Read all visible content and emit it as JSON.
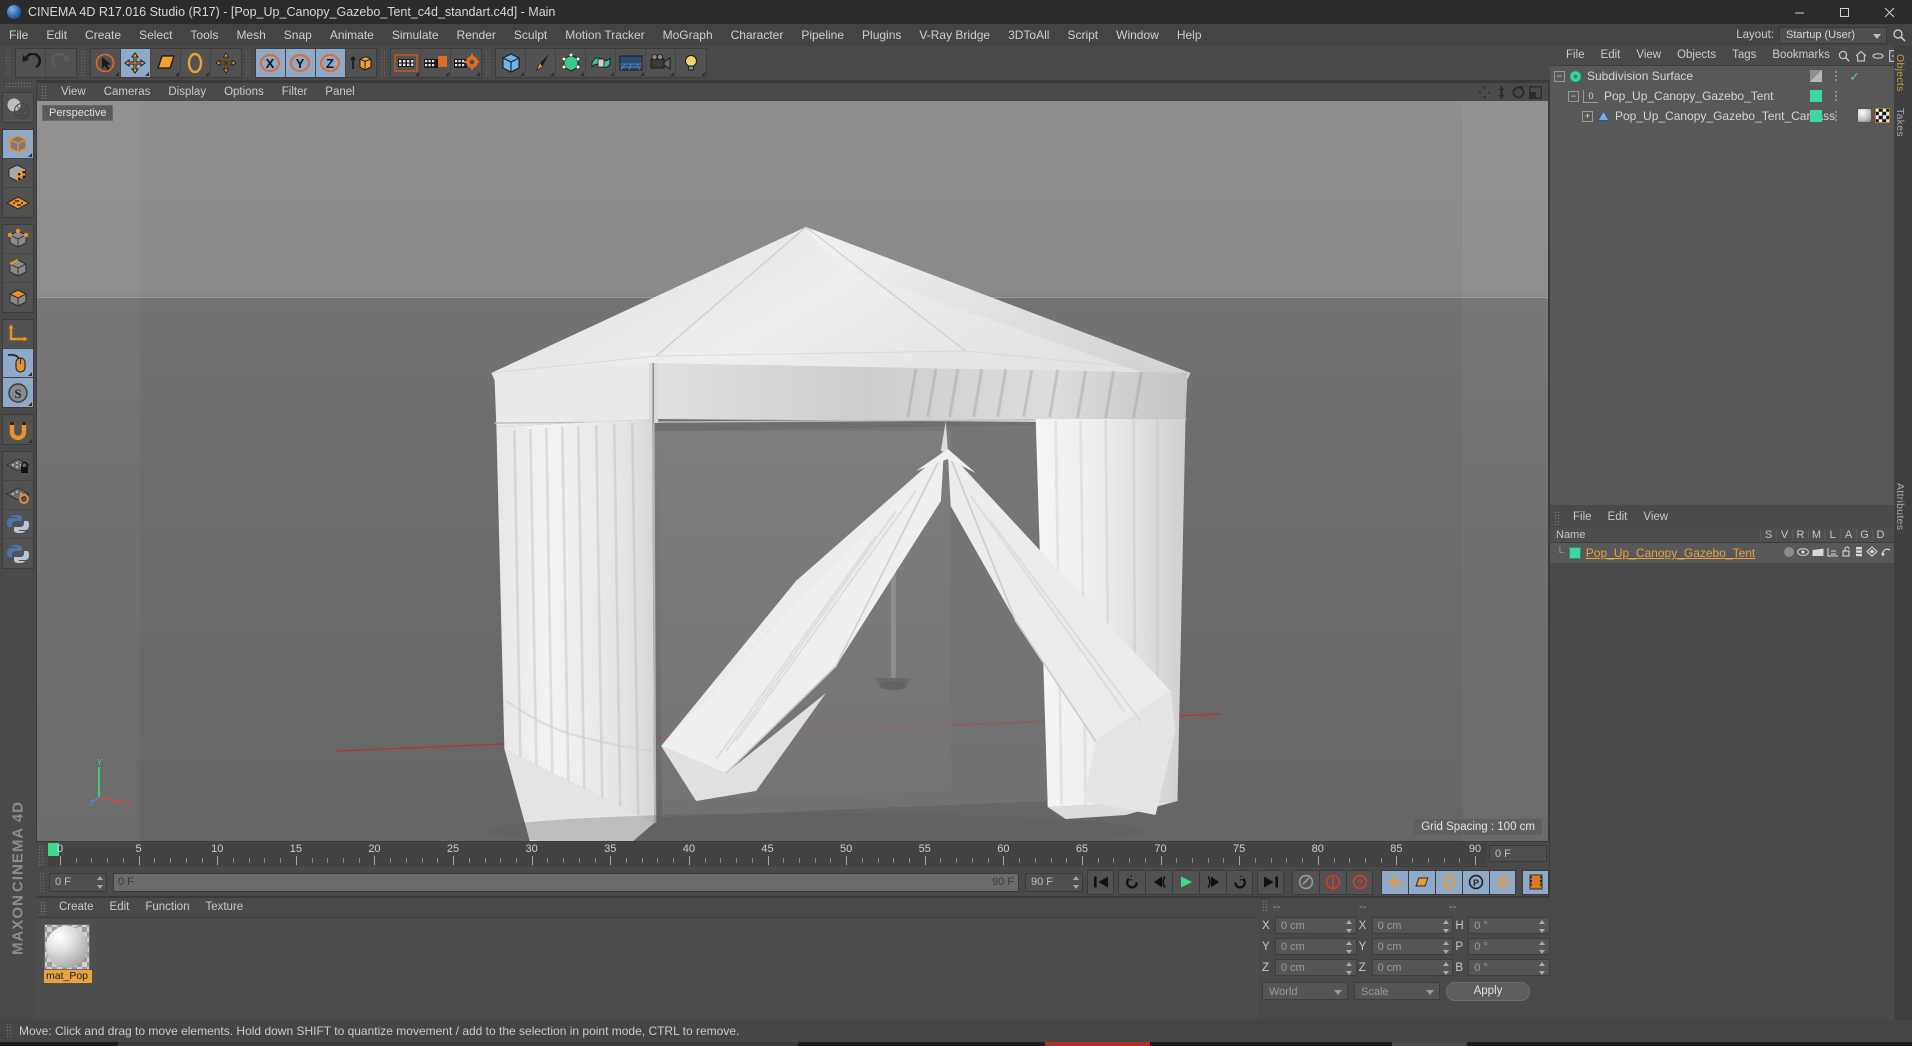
{
  "window": {
    "title": "CINEMA 4D R17.016 Studio (R17) - [Pop_Up_Canopy_Gazebo_Tent_c4d_standart.c4d] - Main",
    "app_icon": "cinema4d-logo-icon",
    "minimize": "minimize-icon",
    "maximize": "maximize-icon",
    "close": "close-icon"
  },
  "menubar": {
    "items": [
      "File",
      "Edit",
      "Create",
      "Select",
      "Tools",
      "Mesh",
      "Snap",
      "Animate",
      "Simulate",
      "Render",
      "Sculpt",
      "Motion Tracker",
      "MoGraph",
      "Character",
      "Pipeline",
      "Plugins",
      "V-Ray Bridge",
      "3DToAll",
      "Script",
      "Window",
      "Help"
    ],
    "layout_label": "Layout:",
    "layout_value": "Startup (User)"
  },
  "toolbar": {
    "groups": [
      {
        "name": "history",
        "buttons": [
          {
            "name": "undo-button",
            "icon": "undo-arrow-icon",
            "state": "normal"
          },
          {
            "name": "redo-button",
            "icon": "redo-arrow-icon",
            "state": "disabled"
          }
        ]
      },
      {
        "name": "transform-tools",
        "buttons": [
          {
            "name": "live-selection-tool",
            "icon": "cursor-select-icon",
            "state": "normal"
          },
          {
            "name": "move-tool",
            "icon": "move-arrows-icon",
            "state": "active"
          },
          {
            "name": "scale-tool",
            "icon": "scale-icon",
            "state": "normal"
          },
          {
            "name": "rotate-tool",
            "icon": "rotate-icon",
            "state": "normal"
          },
          {
            "name": "transform-tool",
            "icon": "transform-icon",
            "state": "normal"
          }
        ]
      },
      {
        "name": "axis-locks",
        "buttons": [
          {
            "name": "lock-x-axis",
            "icon": "x-axis-icon",
            "state": "active"
          },
          {
            "name": "lock-y-axis",
            "icon": "y-axis-icon",
            "state": "active"
          },
          {
            "name": "lock-z-axis",
            "icon": "z-axis-icon",
            "state": "active"
          },
          {
            "name": "world-object-coordinates",
            "icon": "world-axis-icon",
            "state": "normal"
          }
        ]
      },
      {
        "name": "render-tools",
        "buttons": [
          {
            "name": "render-view-button",
            "icon": "render-view-icon",
            "state": "normal"
          },
          {
            "name": "render-to-picture-viewer-button",
            "icon": "render-picture-icon",
            "state": "normal"
          },
          {
            "name": "edit-render-settings-button",
            "icon": "render-settings-icon",
            "state": "normal"
          }
        ]
      },
      {
        "name": "create-objects",
        "buttons": [
          {
            "name": "add-cube-button",
            "icon": "cube-icon",
            "state": "normal"
          },
          {
            "name": "add-spline-button",
            "icon": "pen-spline-icon",
            "state": "normal"
          },
          {
            "name": "add-generator-button",
            "icon": "generator-nurbs-icon",
            "state": "normal"
          },
          {
            "name": "add-deformer-button",
            "icon": "deformer-icon",
            "state": "normal"
          },
          {
            "name": "add-environment-button",
            "icon": "environment-floor-icon",
            "state": "normal"
          },
          {
            "name": "add-camera-button",
            "icon": "camera-icon",
            "state": "normal"
          },
          {
            "name": "add-light-button",
            "icon": "light-bulb-icon",
            "state": "normal"
          }
        ]
      }
    ]
  },
  "left_palette": {
    "groups": [
      {
        "buttons": [
          {
            "name": "make-editable-button",
            "icon": "make-editable-icon"
          }
        ]
      },
      {
        "buttons": [
          {
            "name": "model-mode-button",
            "icon": "model-mode-icon",
            "state": "active"
          },
          {
            "name": "texture-mode-button",
            "icon": "texture-mode-icon",
            "state": "normal"
          },
          {
            "name": "workplane-mode-button",
            "icon": "workplane-icon",
            "state": "normal"
          }
        ]
      },
      {
        "buttons": [
          {
            "name": "point-mode-button",
            "icon": "point-mode-icon",
            "state": "normal"
          },
          {
            "name": "edge-mode-button",
            "icon": "edge-mode-icon",
            "state": "normal"
          },
          {
            "name": "polygon-mode-button",
            "icon": "polygon-mode-icon",
            "state": "normal"
          }
        ]
      },
      {
        "buttons": [
          {
            "name": "object-axis-mode-button",
            "icon": "object-axis-icon",
            "state": "normal"
          },
          {
            "name": "viewport-solo-button",
            "icon": "mouse-viewport-icon",
            "state": "active"
          },
          {
            "name": "enable-snapping-button",
            "icon": "snap-s-icon",
            "state": "active"
          }
        ]
      },
      {
        "buttons": [
          {
            "name": "magnet-tool-button",
            "icon": "magnet-icon",
            "state": "normal"
          }
        ]
      },
      {
        "buttons": [
          {
            "name": "lock-workplane-button",
            "icon": "workplane-lock-icon",
            "state": "normal"
          },
          {
            "name": "planar-workplane-button",
            "icon": "workplane-rotate-icon",
            "state": "normal"
          },
          {
            "name": "python-script-button",
            "icon": "python-icon",
            "state": "normal"
          },
          {
            "name": "python-generator-button",
            "icon": "python-icon-2",
            "state": "normal"
          }
        ]
      }
    ],
    "brand_line1": "MAXON",
    "brand_line2": "CINEMA 4D"
  },
  "viewport": {
    "menu_items": [
      "View",
      "Cameras",
      "Display",
      "Options",
      "Filter",
      "Panel"
    ],
    "camera_label": "Perspective",
    "grid_spacing": "Grid Spacing : 100 cm",
    "axis_labels": {
      "x": "X",
      "y": "Y",
      "z": "Z"
    },
    "nav_icons": [
      "pan-icon",
      "zoom-icon",
      "orbit-icon",
      "maximize-viewport-icon"
    ],
    "model_description": "white pop-up canopy gazebo tent with open front flaps",
    "background_top": "#8d8d8d",
    "background_bottom": "#6b6b6b"
  },
  "object_manager": {
    "menu_items": [
      "File",
      "Edit",
      "View",
      "Objects",
      "Tags",
      "Bookmarks"
    ],
    "header_icons": [
      "search-icon",
      "home-icon",
      "ellipse-icon",
      "plus-box-icon"
    ],
    "rows": [
      {
        "name": "Subdivision Surface",
        "indent": 0,
        "icon": "subdivision-surface-icon",
        "expander": "minus",
        "tag_color": "#9a9a9a",
        "checked": true,
        "editable_level": ""
      },
      {
        "name": "Pop_Up_Canopy_Gazebo_Tent",
        "indent": 1,
        "icon": "layer-zero-icon",
        "expander": "minus",
        "tag_color": "#3fd6a4",
        "checked": false,
        "editable_level": "0"
      },
      {
        "name": "Pop_Up_Canopy_Gazebo_Tent_Carcass",
        "indent": 2,
        "icon": "polygon-object-icon",
        "expander": "plus",
        "tag_color": "#3fd6a4",
        "checked": false,
        "editable_level": ""
      }
    ],
    "tags": [
      "material-tag-icon",
      "texture-checker-tag-icon"
    ]
  },
  "right_rail": {
    "tabs": [
      "Objects",
      "Takes",
      "Attributes"
    ]
  },
  "layer_manager": {
    "menu_items": [
      "File",
      "Edit",
      "View"
    ],
    "columns": [
      "Name",
      "S",
      "V",
      "R",
      "M",
      "L",
      "A",
      "G",
      "D"
    ],
    "rows": [
      {
        "name": "Pop_Up_Canopy_Gazebo_Tent",
        "color": "#3fd6a4"
      }
    ]
  },
  "timeline": {
    "ticks": [
      0,
      5,
      10,
      15,
      20,
      25,
      30,
      35,
      40,
      45,
      50,
      55,
      60,
      65,
      70,
      75,
      80,
      85,
      90
    ],
    "current_frame_field": "0 F",
    "start_frame": "0 F",
    "preview_min": "0 F",
    "preview_max": "90 F",
    "end_frame": "90 F",
    "transport": [
      {
        "name": "go-to-start-button",
        "icon": "skip-start-icon"
      },
      {
        "name": "play-backwards-loop-button",
        "icon": "loop-back-icon"
      },
      {
        "name": "step-back-button",
        "icon": "step-back-icon"
      },
      {
        "name": "play-button",
        "icon": "play-icon"
      },
      {
        "name": "step-forward-button",
        "icon": "step-forward-icon"
      },
      {
        "name": "play-forwards-loop-button",
        "icon": "loop-forward-icon"
      },
      {
        "name": "go-to-end-button",
        "icon": "skip-end-icon"
      },
      {
        "name": "record-active-objects-button",
        "icon": "key-record-icon"
      },
      {
        "name": "autokeying-button",
        "icon": "autokey-icon"
      },
      {
        "name": "keyframe-selection-button",
        "icon": "question-key-icon"
      },
      {
        "name": "record-position-button",
        "icon": "position-key-icon"
      },
      {
        "name": "record-scale-button",
        "icon": "scale-key-icon"
      },
      {
        "name": "record-rotation-button",
        "icon": "rotation-key-icon"
      },
      {
        "name": "record-parameter-button",
        "icon": "parameter-key-icon"
      },
      {
        "name": "record-pointlevel-button",
        "icon": "plad-key-icon"
      },
      {
        "name": "timeline-toggle-button",
        "icon": "filmstrip-icon"
      }
    ]
  },
  "material_manager": {
    "menu_items": [
      "Create",
      "Edit",
      "Function",
      "Texture"
    ],
    "materials": [
      {
        "name": "mat_Pop",
        "preview": "material-sphere-preview"
      }
    ]
  },
  "coordinates": {
    "headers": [
      "--",
      "--",
      "--"
    ],
    "position": {
      "label_x": "X",
      "label_y": "Y",
      "label_z": "Z",
      "x": "0 cm",
      "y": "0 cm",
      "z": "0 cm"
    },
    "size": {
      "label_x": "X",
      "label_y": "Y",
      "label_z": "Z",
      "x": "0 cm",
      "y": "0 cm",
      "z": "0 cm"
    },
    "rotation": {
      "label_h": "H",
      "label_p": "P",
      "label_b": "B",
      "h": "0 °",
      "p": "0 °",
      "b": "0 °"
    },
    "coord_system": "World",
    "transform_mode": "Scale",
    "apply_label": "Apply"
  },
  "statusbar": {
    "text": "Move: Click and drag to move elements. Hold down SHIFT to quantize movement / add to the selection in point mode, CTRL to remove."
  },
  "colors": {
    "accent_blue": "#8fa9c9",
    "orange": "#e8a33d",
    "green": "#3fd6a4",
    "panel_bg": "#4a4a4a",
    "list_bg": "#585858",
    "title_bg": "#2b2b2b"
  }
}
